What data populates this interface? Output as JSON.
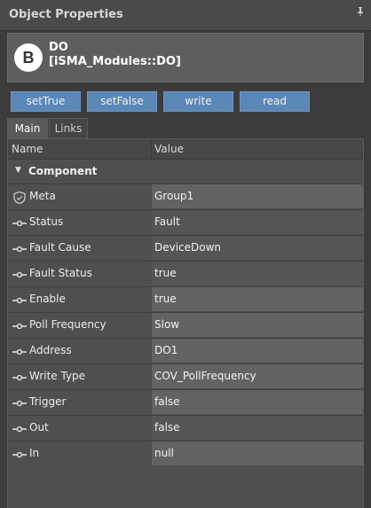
{
  "panel": {
    "title": "Object Properties",
    "pin_icon": "pin-icon"
  },
  "object": {
    "badge": "B",
    "name": "DO",
    "type": "[iSMA_Modules::DO]"
  },
  "actions": [
    "setTrue",
    "setFalse",
    "write",
    "read"
  ],
  "tabs": [
    {
      "label": "Main",
      "active": true
    },
    {
      "label": "Links",
      "active": false
    }
  ],
  "columns": {
    "name": "Name",
    "value": "Value"
  },
  "group": {
    "label": "Component",
    "expanded": true
  },
  "rows": [
    {
      "name": "Meta",
      "value": "Group1",
      "icon": "shield-icon",
      "editable": true
    },
    {
      "name": "Status",
      "value": "Fault",
      "icon": "slot-icon",
      "editable": false
    },
    {
      "name": "Fault Cause",
      "value": "DeviceDown",
      "icon": "slot-icon",
      "editable": false
    },
    {
      "name": "Fault Status",
      "value": "true",
      "icon": "slot-icon",
      "editable": false
    },
    {
      "name": "Enable",
      "value": "true",
      "icon": "slot-icon",
      "editable": true
    },
    {
      "name": "Poll Frequency",
      "value": "Slow",
      "icon": "slot-icon",
      "editable": true
    },
    {
      "name": "Address",
      "value": "DO1",
      "icon": "slot-icon",
      "editable": true
    },
    {
      "name": "Write Type",
      "value": "COV_PollFrequency",
      "icon": "slot-icon",
      "editable": true
    },
    {
      "name": "Trigger",
      "value": "false",
      "icon": "slot-icon",
      "editable": true
    },
    {
      "name": "Out",
      "value": "false",
      "icon": "slot-icon",
      "editable": false
    },
    {
      "name": "In",
      "value": "null",
      "icon": "slot-icon",
      "editable": true
    }
  ]
}
